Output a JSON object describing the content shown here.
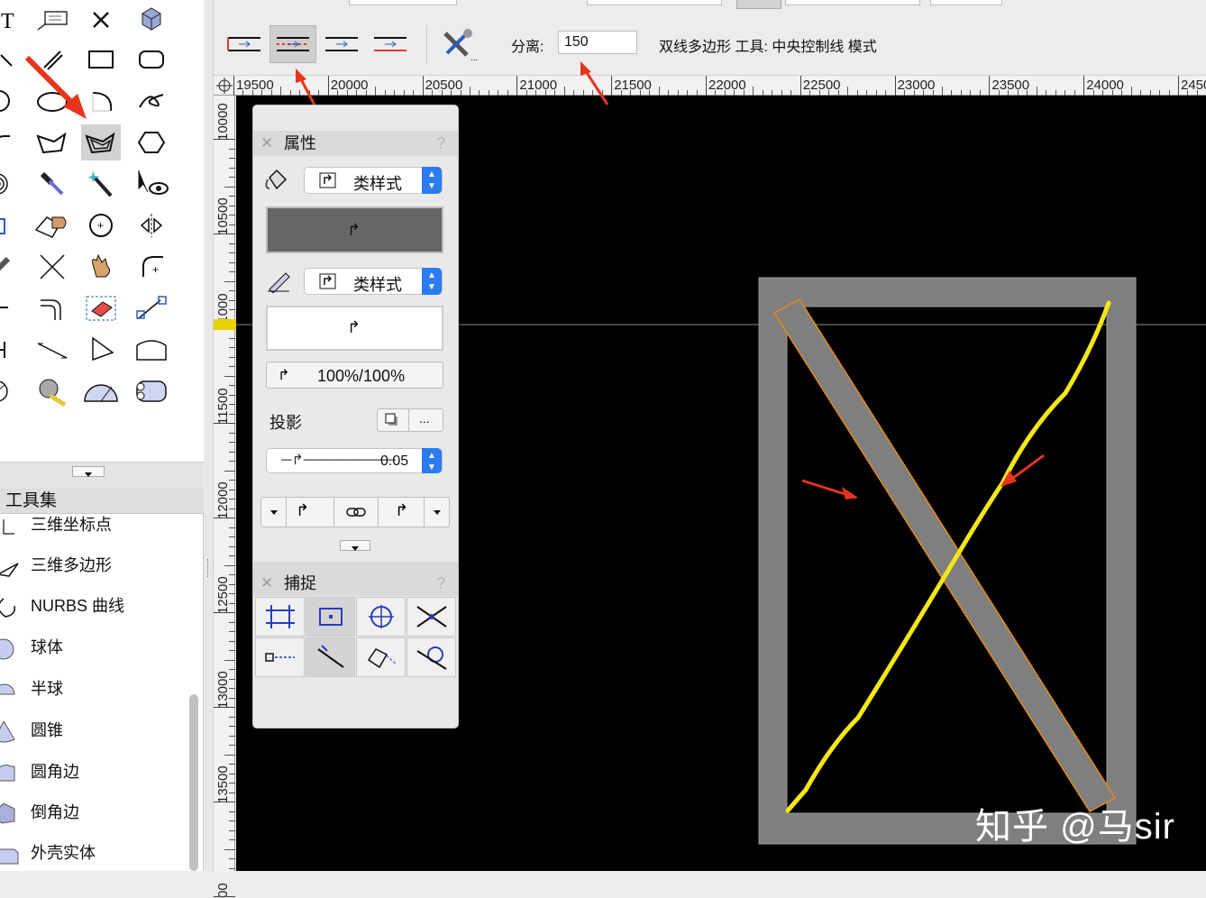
{
  "mode_bar": {
    "offset_label": "分离:",
    "offset_value": "150",
    "mode_description": "双线多边形 工具: 中央控制线 模式"
  },
  "ruler_top": {
    "labels": [
      "19500",
      "20000",
      "20500",
      "21000",
      "21500",
      "22000",
      "22500",
      "23000",
      "23500",
      "24000",
      "2450"
    ]
  },
  "ruler_left": {
    "labels": [
      "10000",
      "10500",
      "11000",
      "11500",
      "12000",
      "12500",
      "13000",
      "13500",
      "00"
    ]
  },
  "toolset": {
    "title": "工具集",
    "items": [
      "三维坐标点",
      "三维多边形",
      "NURBS 曲线",
      "球体",
      "半球",
      "圆锥",
      "圆角边",
      "倒角边",
      "外壳实体"
    ]
  },
  "attributes_panel": {
    "title": "属性",
    "help": "?",
    "fill_style": "类样式",
    "pen_style": "类样式",
    "opacity": "100%/100%",
    "shadow_label": "投影",
    "shadow_more": "...",
    "line_weight": "0.05"
  },
  "snap_panel": {
    "title": "捕捉",
    "help": "?"
  },
  "watermark": "知乎 @马sir",
  "colors": {
    "accent_blue": "#2b7cf3",
    "annotation_red": "#e8341c",
    "highlight_yellow": "#f5e617",
    "selection_orange": "#e58b17",
    "wall_gray": "#7f7f7f"
  }
}
